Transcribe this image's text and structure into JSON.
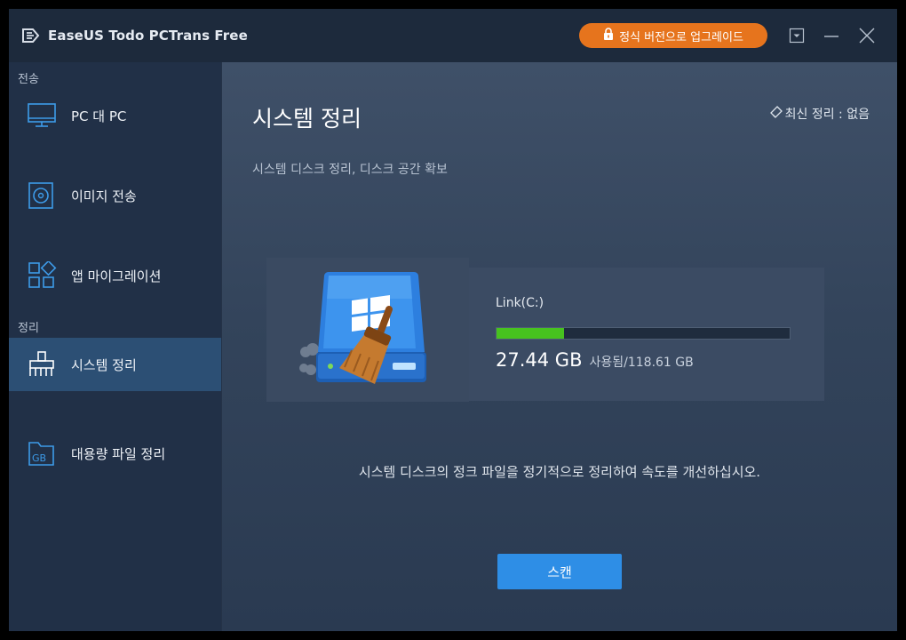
{
  "window": {
    "title": "EaseUS Todo PCTrans Free",
    "upgrade_label": "정식 버전으로 업그레이드"
  },
  "colors": {
    "accent": "#2e8ee6",
    "upgrade": "#e6741d",
    "usage_bar": "#47c21f",
    "sidebar_active": "#2c4f74"
  },
  "sidebar": {
    "section_transfer": "전송",
    "section_cleanup": "정리",
    "items": [
      {
        "label": "PC 대 PC",
        "icon": "monitor-icon"
      },
      {
        "label": "이미지 전송",
        "icon": "disc-icon"
      },
      {
        "label": "앱 마이그레이션",
        "icon": "apps-grid-icon"
      },
      {
        "label": "시스템 정리",
        "icon": "broom-icon",
        "active": true
      },
      {
        "label": "대용량 파일 정리",
        "icon": "gb-folder-icon"
      }
    ]
  },
  "main": {
    "title": "시스템 정리",
    "subtitle": "시스템 디스크 정리, 디스크 공간 확보",
    "last_clean": "최신 정리 : 없음",
    "drive": {
      "name": "Link(C:)",
      "used": "27.44 GB",
      "used_label": "사용됨",
      "total": "/118.61 GB",
      "used_fraction": 0.2313
    },
    "description": "시스템 디스크의 정크 파일을 정기적으로 정리하여 속도를 개선하십시오.",
    "scan_label": "스캔"
  }
}
